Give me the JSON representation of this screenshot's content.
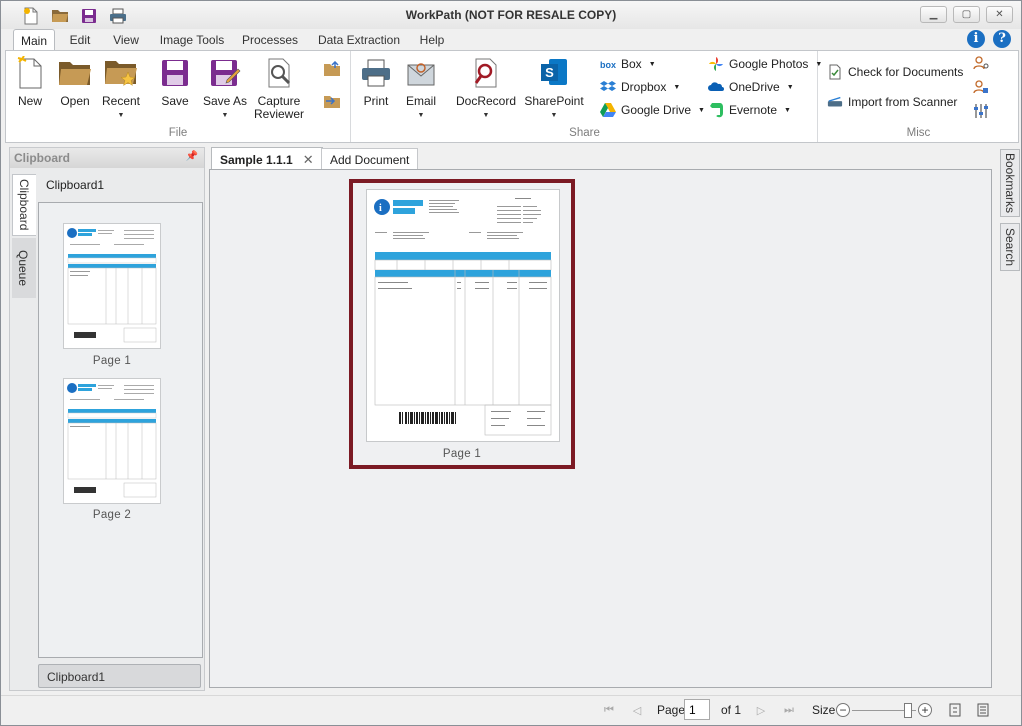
{
  "window": {
    "title": "WorkPath (NOT FOR RESALE COPY)",
    "minimize": "▭",
    "restore": "□",
    "close": "✕"
  },
  "ribbon_tabs": [
    "Main",
    "Edit",
    "View",
    "Image Tools",
    "Processes",
    "Data Extraction",
    "Help"
  ],
  "ribbon": {
    "file": {
      "label": "File",
      "new": "New",
      "open": "Open",
      "recent": "Recent",
      "save": "Save",
      "save_as": "Save As",
      "capture_reviewer_1": "Capture",
      "capture_reviewer_2": "Reviewer"
    },
    "share": {
      "label": "Share",
      "print": "Print",
      "email": "Email",
      "docrecord": "DocRecord",
      "sharepoint": "SharePoint",
      "box": "Box",
      "dropbox": "Dropbox",
      "google_drive": "Google Drive",
      "google_photos": "Google Photos",
      "onedrive": "OneDrive",
      "evernote": "Evernote"
    },
    "misc": {
      "label": "Misc",
      "check_docs": "Check for Documents",
      "import_scanner": "Import from Scanner"
    }
  },
  "left_panel": {
    "header": "Clipboard",
    "vtab_clipboard": "Clipboard",
    "vtab_queue": "Queue",
    "clipboard_title": "Clipboard1",
    "thumbs": [
      {
        "label": "Page 1"
      },
      {
        "label": "Page 2"
      }
    ],
    "footer": "Clipboard1"
  },
  "doc_tabs": {
    "active": "Sample 1.1.1",
    "add": "Add Document"
  },
  "viewer": {
    "page_label": "Page 1"
  },
  "right_tabs": {
    "bookmarks": "Bookmarks",
    "search": "Search"
  },
  "statusbar": {
    "page_label": "Page",
    "page_value": "1",
    "of_label": "of 1",
    "size_label": "Size"
  },
  "colors": {
    "selection_border": "#7b1a24",
    "table_header_blue": "#2ea3dc",
    "accent_blue": "#1b6fc2"
  }
}
